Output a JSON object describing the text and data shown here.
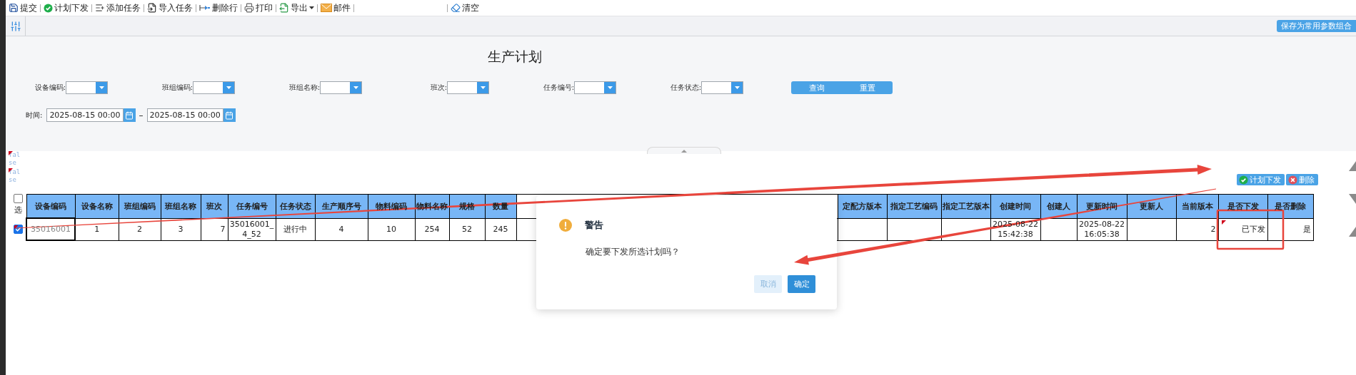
{
  "toolbar": {
    "items": [
      {
        "label": "提交",
        "dropdown": false
      },
      {
        "label": "计划下发",
        "dropdown": false
      },
      {
        "label": "添加任务",
        "dropdown": false
      },
      {
        "label": "导入任务",
        "dropdown": false
      },
      {
        "label": "删除行",
        "dropdown": false
      },
      {
        "label": "打印",
        "dropdown": false
      },
      {
        "label": "导出",
        "dropdown": true
      },
      {
        "label": "邮件",
        "dropdown": false
      }
    ],
    "tail_items": [
      {
        "label": "清空",
        "dropdown": false
      }
    ]
  },
  "save_preset_button": "保存为常用参数组合",
  "title": "生产计划",
  "filters": [
    {
      "label": "设备编码:"
    },
    {
      "label": "班组编码:"
    },
    {
      "label": "班组名称:"
    },
    {
      "label": "班次:"
    },
    {
      "label": "任务编号:"
    },
    {
      "label": "任务状态:"
    }
  ],
  "search_buttons": [
    "查询",
    "重置"
  ],
  "time_filter": {
    "label": "时间:",
    "from": "2025-08-15 00:00",
    "separator": "–",
    "to": "2025-08-15 00:00"
  },
  "status_flags": [
    {
      "text": "false",
      "modified": true
    },
    {
      "text": "false",
      "modified": true
    }
  ],
  "row_actions": [
    {
      "label": "计划下发",
      "kind": "release"
    },
    {
      "label": "删除",
      "kind": "delete"
    }
  ],
  "table": {
    "select_header": {
      "label": "选",
      "checked": false
    },
    "columns": [
      {
        "kind": "text",
        "label": "设备编码"
      },
      {
        "kind": "text",
        "label": "设备名称"
      },
      {
        "kind": "text",
        "label": "班组编码"
      },
      {
        "kind": "text",
        "label": "班组名称"
      },
      {
        "kind": "text",
        "label": "班次"
      },
      {
        "kind": "text",
        "label": "任务编号"
      },
      {
        "kind": "text",
        "label": "任务状态"
      },
      {
        "kind": "text",
        "label": "生产顺序号"
      },
      {
        "kind": "text",
        "label": "物料编码"
      },
      {
        "kind": "text",
        "label": "物料名称"
      },
      {
        "kind": "text",
        "label": "规格"
      },
      {
        "kind": "text",
        "label": "数量"
      },
      {
        "kind": "covered"
      },
      {
        "kind": "text",
        "label": "定配方版本"
      },
      {
        "kind": "text",
        "label": "指定工艺编码"
      },
      {
        "kind": "text",
        "label": "指定工艺版本"
      },
      {
        "kind": "text",
        "label": "创建时间"
      },
      {
        "kind": "text",
        "label": "创建人"
      },
      {
        "kind": "text",
        "label": "更新时间"
      },
      {
        "kind": "text",
        "label": "更新人"
      },
      {
        "kind": "text",
        "label": "当前版本"
      },
      {
        "kind": "text",
        "label": "是否下发"
      },
      {
        "kind": "text",
        "label": "是否删除"
      }
    ],
    "rows": [
      {
        "selected": true,
        "modified": true,
        "cells": [
          {
            "text": "35016001",
            "focused": true,
            "modified": false
          },
          {
            "text": "1",
            "focused": false,
            "modified": false
          },
          {
            "text": "2",
            "focused": false,
            "modified": false
          },
          {
            "text": "3",
            "focused": false,
            "modified": false
          },
          {
            "text": "7",
            "focused": false,
            "modified": false
          },
          {
            "text": "35016001_4_52",
            "focused": false,
            "modified": false
          },
          {
            "text": "进行中",
            "focused": false,
            "modified": false
          },
          {
            "text": "4",
            "focused": false,
            "modified": false
          },
          {
            "text": "10",
            "focused": false,
            "modified": false
          },
          {
            "text": "254",
            "focused": false,
            "modified": false
          },
          {
            "text": "52",
            "focused": false,
            "modified": false
          },
          {
            "text": "245",
            "focused": false,
            "modified": false
          },
          {
            "focused": false,
            "modified": false
          },
          {
            "focused": false,
            "modified": false
          },
          {
            "focused": false,
            "modified": false
          },
          {
            "focused": false,
            "modified": false
          },
          {
            "text": "2025-08-22 15:42:38",
            "focused": false,
            "modified": false
          },
          {
            "focused": false,
            "modified": false
          },
          {
            "text": "2025-08-22 16:05:38",
            "focused": false,
            "modified": false
          },
          {
            "focused": false,
            "modified": false
          },
          {
            "text": "2",
            "focused": false,
            "modified": false
          },
          {
            "text": "已下发",
            "focused": false,
            "modified": true
          },
          {
            "text": "是",
            "focused": false,
            "modified": false
          }
        ]
      }
    ]
  },
  "dialog": {
    "title": "警告",
    "message": "确定要下发所选计划吗？",
    "buttons": [
      {
        "label": "取消",
        "kind": "secondary"
      },
      {
        "label": "确定",
        "kind": "primary"
      }
    ]
  }
}
